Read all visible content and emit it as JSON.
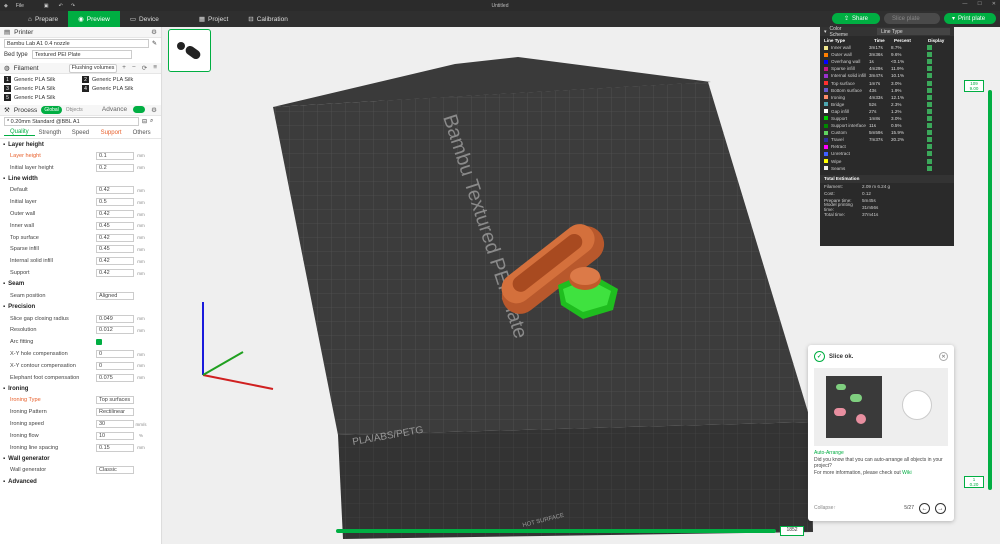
{
  "window": {
    "title": "Untitled",
    "menu": "File"
  },
  "tabs": [
    {
      "label": "Prepare"
    },
    {
      "label": "Preview"
    },
    {
      "label": "Device"
    },
    {
      "label": "Project"
    },
    {
      "label": "Calibration"
    }
  ],
  "actions": {
    "share": "Share",
    "slice": "Slice plate",
    "print": "Print plate"
  },
  "printer": {
    "title": "Printer",
    "name": "Bambu Lab A1 0.4 nozzle",
    "bed_label": "Bed type",
    "bed_value": "Textured PEI Plate"
  },
  "filament": {
    "title": "Filament",
    "badge": "Flushing volumes",
    "items": [
      {
        "n": "1",
        "name": "Generic PLA Silk"
      },
      {
        "n": "2",
        "name": "Generic PLA Silk"
      },
      {
        "n": "3",
        "name": "Generic PLA Silk"
      },
      {
        "n": "4",
        "name": "Generic PLA Silk"
      },
      {
        "n": "5",
        "name": "Generic PLA Silk"
      }
    ]
  },
  "process": {
    "title": "Process",
    "global": "Global",
    "objects": "Objects",
    "advance": "Advance",
    "profile": "* 0.20mm Standard @BBL A1",
    "tabs": [
      "Quality",
      "Strength",
      "Speed",
      "Support",
      "Others"
    ]
  },
  "groups": [
    {
      "name": "Layer height",
      "params": [
        {
          "l": "Layer height",
          "v": "0.1",
          "u": "mm",
          "hl": true
        },
        {
          "l": "Initial layer height",
          "v": "0.2",
          "u": "mm"
        }
      ]
    },
    {
      "name": "Line width",
      "params": [
        {
          "l": "Default",
          "v": "0.42",
          "u": "mm"
        },
        {
          "l": "Initial layer",
          "v": "0.5",
          "u": "mm"
        },
        {
          "l": "Outer wall",
          "v": "0.42",
          "u": "mm"
        },
        {
          "l": "Inner wall",
          "v": "0.45",
          "u": "mm"
        },
        {
          "l": "Top surface",
          "v": "0.42",
          "u": "mm"
        },
        {
          "l": "Sparse infill",
          "v": "0.45",
          "u": "mm"
        },
        {
          "l": "Internal solid infill",
          "v": "0.42",
          "u": "mm"
        },
        {
          "l": "Support",
          "v": "0.42",
          "u": "mm"
        }
      ]
    },
    {
      "name": "Seam",
      "params": [
        {
          "l": "Seam position",
          "v": "Aligned",
          "u": ""
        }
      ]
    },
    {
      "name": "Precision",
      "params": [
        {
          "l": "Slice gap closing radius",
          "v": "0.049",
          "u": "mm"
        },
        {
          "l": "Resolution",
          "v": "0.012",
          "u": "mm"
        },
        {
          "l": "Arc fitting",
          "v": "",
          "u": "",
          "chk": true
        },
        {
          "l": "X-Y hole compensation",
          "v": "0",
          "u": "mm"
        },
        {
          "l": "X-Y contour compensation",
          "v": "0",
          "u": "mm"
        },
        {
          "l": "Elephant foot compensation",
          "v": "0.075",
          "u": "mm"
        }
      ]
    },
    {
      "name": "Ironing",
      "params": [
        {
          "l": "Ironing Type",
          "v": "Top surfaces",
          "u": "",
          "hl": true
        },
        {
          "l": "Ironing Pattern",
          "v": "Rectilinear",
          "u": ""
        },
        {
          "l": "Ironing speed",
          "v": "30",
          "u": "mm/s"
        },
        {
          "l": "Ironing flow",
          "v": "10",
          "u": "%"
        },
        {
          "l": "Ironing line spacing",
          "v": "0.15",
          "u": "mm"
        }
      ]
    },
    {
      "name": "Wall generator",
      "params": [
        {
          "l": "Wall generator",
          "v": "Classic",
          "u": ""
        }
      ]
    },
    {
      "name": "Advanced",
      "params": []
    }
  ],
  "plate": {
    "label1": "Bambu Textured PEI Plate",
    "label2": "PLA/ABS/PETG",
    "label3": "HOT SURFACE"
  },
  "legend": {
    "title": "Color Scheme",
    "scheme": "Line Type",
    "cols": [
      "Line Type",
      "Time",
      "Percent",
      "Display"
    ],
    "rows": [
      {
        "n": "Inner wall",
        "t": "3m17s",
        "p": "8.7%",
        "c": "#f0e68c"
      },
      {
        "n": "Outer wall",
        "t": "3m36s",
        "p": "9.6%",
        "c": "#ff7f00"
      },
      {
        "n": "Overhang wall",
        "t": "1s",
        "p": "<0.1%",
        "c": "#0000ff"
      },
      {
        "n": "Sparse infill",
        "t": "4m29s",
        "p": "11.9%",
        "c": "#c71585"
      },
      {
        "n": "Internal solid infill",
        "t": "3m47s",
        "p": "10.1%",
        "c": "#9932cc"
      },
      {
        "n": "Top surface",
        "t": "1m7s",
        "p": "3.0%",
        "c": "#ff3030"
      },
      {
        "n": "Bottom surface",
        "t": "43s",
        "p": "1.9%",
        "c": "#6a5acd"
      },
      {
        "n": "Ironing",
        "t": "4m33s",
        "p": "12.1%",
        "c": "#ff8c69"
      },
      {
        "n": "Bridge",
        "t": "52s",
        "p": "2.3%",
        "c": "#4da6b0"
      },
      {
        "n": "Gap infill",
        "t": "27s",
        "p": "1.2%",
        "c": "#ffffff"
      },
      {
        "n": "Support",
        "t": "1m8s",
        "p": "3.0%",
        "c": "#00cc00"
      },
      {
        "n": "Support interface",
        "t": "11s",
        "p": "0.5%",
        "c": "#008800"
      },
      {
        "n": "Custom",
        "t": "5m59s",
        "p": "15.9%",
        "c": "#5fd35f"
      },
      {
        "n": "Travel",
        "t": "7m37s",
        "p": "20.2%",
        "c": "#2d2d9e"
      },
      {
        "n": "Retract",
        "t": "",
        "p": "",
        "c": "#ff00ff"
      },
      {
        "n": "Unretract",
        "t": "",
        "p": "",
        "c": "#4060ff"
      },
      {
        "n": "Wipe",
        "t": "",
        "p": "",
        "c": "#ffff00"
      },
      {
        "n": "Seams",
        "t": "",
        "p": "",
        "c": "#eeeeee"
      }
    ],
    "total_title": "Total Estimation",
    "totals": [
      {
        "k": "Filament:",
        "v": "2.09 m    6.24 g"
      },
      {
        "k": "Cost:",
        "v": "0.12"
      },
      {
        "k": "Prepare time:",
        "v": "5m45s"
      },
      {
        "k": "Model printing time:",
        "v": "31m56s"
      },
      {
        "k": "Total time:",
        "v": "37m41s"
      }
    ]
  },
  "layers": {
    "top": "109",
    "top_h": "9.00",
    "bottom": "1",
    "bottom_h": "0.20"
  },
  "moves": {
    "value": "1852"
  },
  "popup": {
    "status": "Slice ok.",
    "tip_title": "Auto-Arrange",
    "tip_text": "Did you know that you can auto-arrange all objects in your project?",
    "more": "For more information, please check out",
    "link": "Wiki",
    "collapse": "Collapse↑",
    "page": "5/27"
  }
}
